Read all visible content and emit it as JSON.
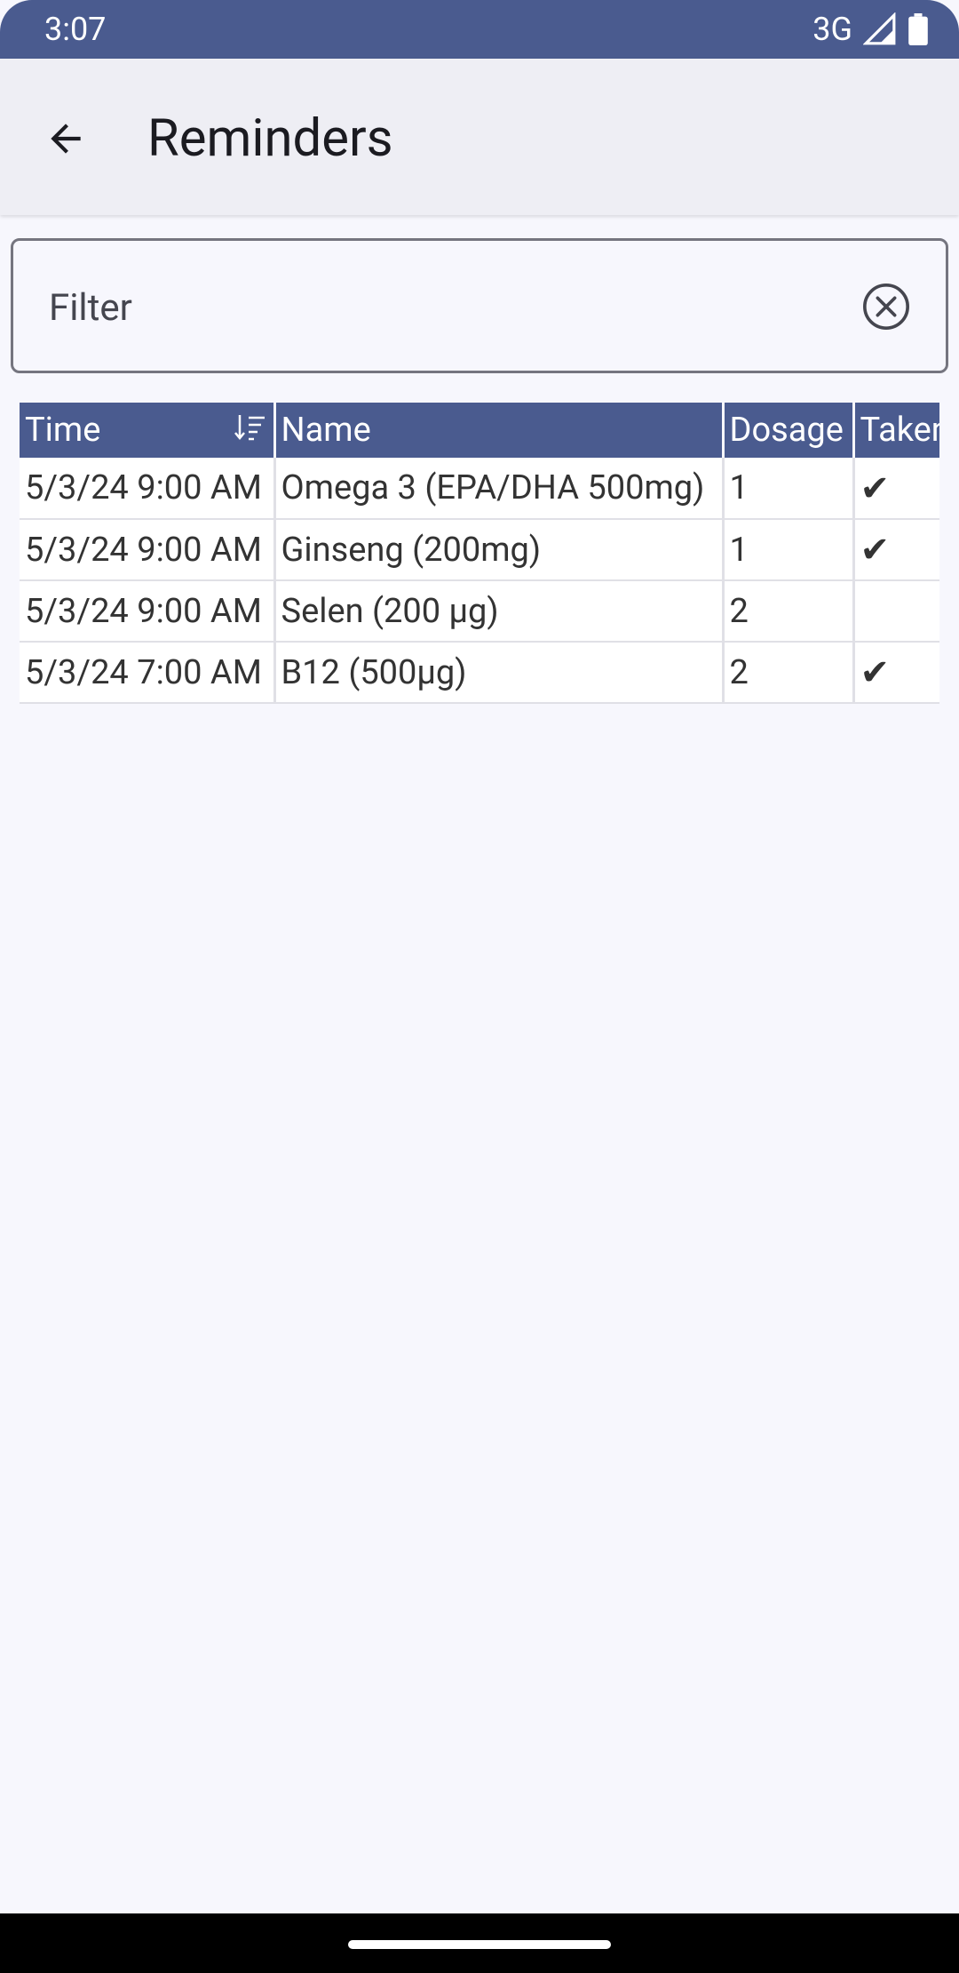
{
  "status_bar": {
    "time": "3:07",
    "network": "3G"
  },
  "app_bar": {
    "title": "Reminders"
  },
  "filter": {
    "placeholder": "Filter",
    "value": ""
  },
  "table": {
    "columns": [
      "Time",
      "Name",
      "Dosage",
      "Taken"
    ],
    "rows": [
      {
        "time": "5/3/24 9:00 AM",
        "name": "Omega 3 (EPA/DHA 500mg)",
        "dosage": "1",
        "taken": "✔"
      },
      {
        "time": "5/3/24 9:00 AM",
        "name": "Ginseng (200mg)",
        "dosage": "1",
        "taken": "✔"
      },
      {
        "time": "5/3/24 9:00 AM",
        "name": "Selen (200 µg)",
        "dosage": "2",
        "taken": ""
      },
      {
        "time": "5/3/24 7:00 AM",
        "name": "B12 (500µg)",
        "dosage": "2",
        "taken": "✔"
      }
    ]
  },
  "colors": {
    "accent": "#4a5b8f",
    "background": "#f7f7fd",
    "app_bar": "#eeeef4"
  }
}
